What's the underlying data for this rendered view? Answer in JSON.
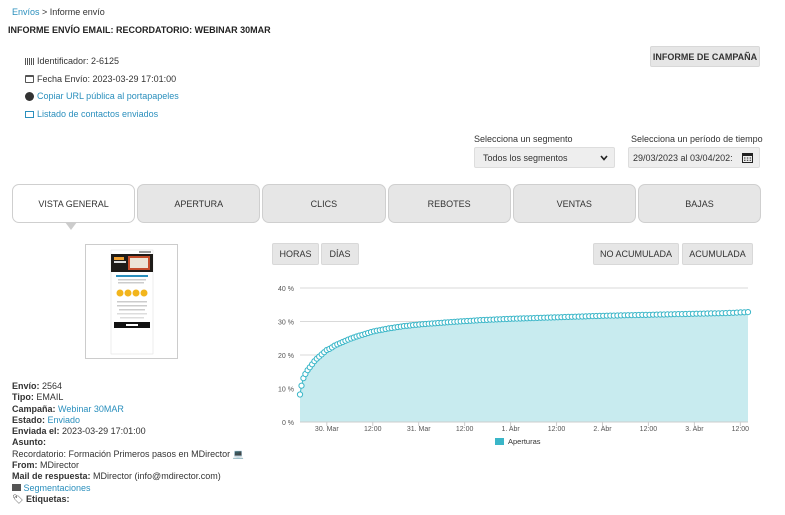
{
  "breadcrumb": {
    "link": "Envíos",
    "separator": " > ",
    "current": "Informe envío"
  },
  "page_title": "INFORME ENVÍO EMAIL: RECORDATORIO: WEBINAR 30MAR",
  "campaign_report_button": "INFORME DE CAMPAÑA",
  "meta": {
    "identifier": "Identificador: 2-6125",
    "send_date": "Fecha Envío: 2023-03-29 17:01:00",
    "copy_url": "Copiar URL pública al portapapeles",
    "contacts_list": "Listado de contactos enviados"
  },
  "filters": {
    "segment_label": "Selecciona un segmento",
    "segment_value": "Todos los segmentos",
    "period_label": "Selecciona un período de tiempo",
    "period_value": "29/03/2023 al 03/04/202:"
  },
  "tabs": [
    "VISTA GENERAL",
    "APERTURA",
    "CLICS",
    "REBOTES",
    "VENTAS",
    "BAJAS"
  ],
  "details": {
    "envio_label": "Envío:",
    "envio_value": "2564",
    "tipo_label": "Tipo:",
    "tipo_value": "EMAIL",
    "campana_label": "Campaña:",
    "campana_value": "Webinar 30MAR",
    "estado_label": "Estado:",
    "estado_value": "Enviado",
    "enviada_label": "Enviada el:",
    "enviada_value": "2023-03-29 17:01:00",
    "asunto_label": "Asunto:",
    "asunto_value": "Recordatorio: Formación Primeros pasos en MDirector 💻",
    "from_label": "From:",
    "from_value": "MDirector",
    "reply_label": "Mail de respuesta:",
    "reply_value": "MDirector (info@mdirector.com)",
    "segmentaciones": "Segmentaciones",
    "etiquetas_label": "Etiquetas:"
  },
  "chart_controls": {
    "hours": "HORAS",
    "days": "DÍAS",
    "no_cumulative": "NO ACUMULADA",
    "cumulative": "ACUMULADA"
  },
  "chart_data": {
    "type": "area",
    "ylim": [
      0,
      40
    ],
    "y_ticks": [
      "0 %",
      "10 %",
      "20 %",
      "30 %",
      "40 %"
    ],
    "x_ticks": [
      "30. Mar",
      "12:00",
      "31. Mar",
      "12:00",
      "1. Abr",
      "12:00",
      "2. Abr",
      "12:00",
      "3. Abr",
      "12:00"
    ],
    "x_range_hours": [
      17,
      134
    ],
    "series": [
      {
        "name": "Aperturas",
        "color": "#3ab6c8"
      }
    ],
    "points_hours": [
      17,
      17.5,
      18,
      19,
      20,
      21,
      22,
      23,
      24,
      25,
      26,
      28,
      30,
      32,
      34,
      36,
      40,
      44,
      48,
      56,
      64,
      72,
      80,
      88,
      96,
      104,
      112,
      120,
      128,
      134
    ],
    "points_values": [
      8.2,
      11.5,
      13.5,
      15.5,
      17,
      18.5,
      19.5,
      20.5,
      21.5,
      22,
      22.8,
      23.8,
      24.8,
      25.6,
      26.3,
      27,
      27.9,
      28.6,
      29.1,
      29.8,
      30.4,
      30.8,
      31.1,
      31.4,
      31.7,
      31.9,
      32.1,
      32.3,
      32.5,
      32.8
    ],
    "marker_count": 140
  }
}
